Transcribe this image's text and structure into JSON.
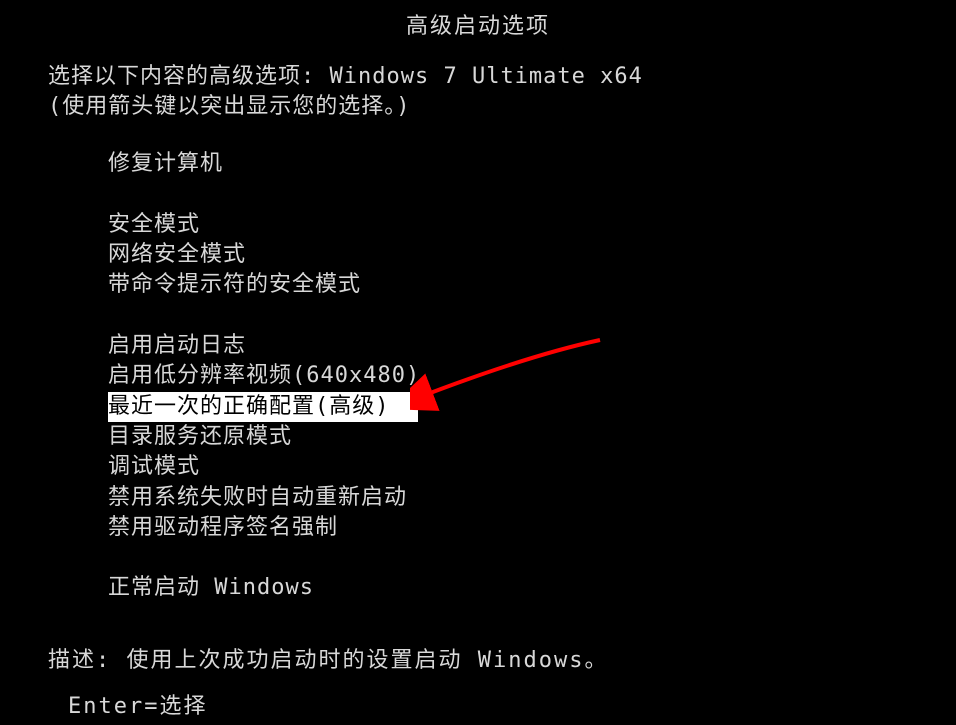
{
  "title": "高级启动选项",
  "instruction_line1_prefix": "选择以下内容的高级选项:",
  "os_name": "Windows 7 Ultimate x64",
  "instruction_line2": "(使用箭头键以突出显示您的选择。)",
  "menu": {
    "group1": [
      "修复计算机"
    ],
    "group2": [
      "安全模式",
      "网络安全模式",
      "带命令提示符的安全模式"
    ],
    "group3": [
      "启用启动日志",
      "启用低分辨率视频(640x480)",
      "最近一次的正确配置(高级)",
      "目录服务还原模式",
      "调试模式",
      "禁用系统失败时自动重新启动",
      "禁用驱动程序签名强制"
    ],
    "group4": [
      "正常启动 Windows"
    ]
  },
  "selected_item": "最近一次的正确配置(高级)",
  "description": {
    "label": "描述:",
    "text": "使用上次成功启动时的设置启动 Windows。"
  },
  "footer": "Enter=选择"
}
